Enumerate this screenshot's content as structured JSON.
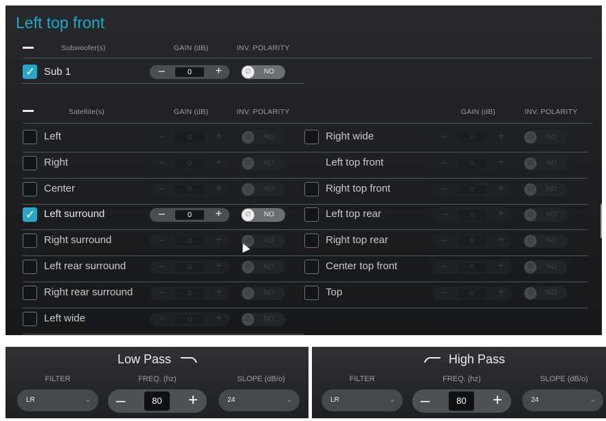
{
  "section": {
    "title": "Left top front"
  },
  "subwoofer": {
    "header": "Subwoofer(s)",
    "gain_header": "GAIN (dB)",
    "polarity_header": "INV. POLARITY",
    "items": [
      {
        "label": "Sub 1",
        "checked": true,
        "gain": "0",
        "polarity": "NO"
      }
    ]
  },
  "satellite": {
    "header": "Satellite(s)",
    "gain_header": "GAIN (dB)",
    "polarity_header": "INV. POLARITY",
    "gain_header_right": "GAIN (dB)",
    "polarity_header_right": "INV. POLARITY",
    "left_items": [
      {
        "label": "Left",
        "checked": false,
        "gain": "0",
        "polarity": "NO"
      },
      {
        "label": "Right",
        "checked": false,
        "gain": "0",
        "polarity": "NO"
      },
      {
        "label": "Center",
        "checked": false,
        "gain": "0",
        "polarity": "NO"
      },
      {
        "label": "Left surround",
        "checked": true,
        "gain": "0",
        "polarity": "NO"
      },
      {
        "label": "Right surround",
        "checked": false,
        "gain": "0",
        "polarity": "NO"
      },
      {
        "label": "Left rear surround",
        "checked": false,
        "gain": "0",
        "polarity": "NO"
      },
      {
        "label": "Right rear surround",
        "checked": false,
        "gain": "0",
        "polarity": "NO"
      },
      {
        "label": "Left wide",
        "checked": false,
        "gain": "0",
        "polarity": "NO"
      }
    ],
    "right_items": [
      {
        "label": "Right wide",
        "checked": false,
        "gain": "0",
        "polarity": "NO"
      },
      {
        "label": "Left top front",
        "checked": false,
        "gain": "0",
        "polarity": "NO"
      },
      {
        "label": "Right top front",
        "checked": false,
        "gain": "0",
        "polarity": "NO"
      },
      {
        "label": "Left top rear",
        "checked": false,
        "gain": "0",
        "polarity": "NO"
      },
      {
        "label": "Right top rear",
        "checked": false,
        "gain": "0",
        "polarity": "NO"
      },
      {
        "label": "Center top front",
        "checked": false,
        "gain": "0",
        "polarity": "NO"
      },
      {
        "label": "Top",
        "checked": false,
        "gain": "0",
        "polarity": "NO"
      }
    ]
  },
  "low_pass": {
    "title": "Low Pass",
    "filter_label": "FILTER",
    "filter_value": "LR",
    "freq_label": "FREQ. (hz)",
    "freq_value": "80",
    "slope_label": "SLOPE (dB/o)",
    "slope_value": "24"
  },
  "high_pass": {
    "title": "High Pass",
    "filter_label": "FILTER",
    "filter_value": "LR",
    "freq_label": "FREQ. (hz)",
    "freq_value": "80",
    "slope_label": "SLOPE (dB/o)",
    "slope_value": "24"
  },
  "colors": {
    "accent": "#2aa6c8",
    "title": "#25a7c7"
  }
}
